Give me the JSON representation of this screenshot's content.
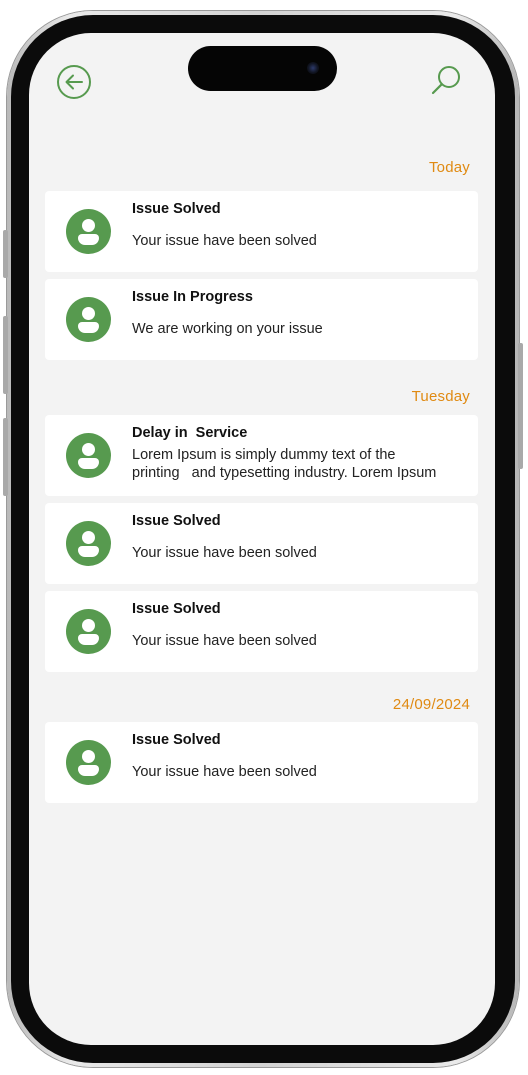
{
  "header": {
    "back_icon": "back-arrow-circle-icon",
    "search_icon": "search-icon"
  },
  "colors": {
    "accent_green": "#579a4f",
    "section_orange": "#e08a12",
    "screen_bg": "#f3f3f3"
  },
  "sections": [
    {
      "label": "Today",
      "items": [
        {
          "title": "Issue Solved",
          "text": "Your issue have been solved"
        },
        {
          "title": "Issue In Progress",
          "text": "We are working on your issue"
        }
      ]
    },
    {
      "label": "Tuesday",
      "items": [
        {
          "title": "Delay in  Service",
          "text_line1": "Lorem Ipsum is simply dummy text of the",
          "text_line2": "printing   and typesetting industry. Lorem Ipsum"
        },
        {
          "title": "Issue Solved",
          "text": "Your issue have been solved"
        },
        {
          "title": "Issue Solved",
          "text": "Your issue have been solved"
        }
      ]
    },
    {
      "label": "24/09/2024",
      "items": [
        {
          "title": "Issue Solved",
          "text": "Your issue have been solved"
        }
      ]
    }
  ]
}
